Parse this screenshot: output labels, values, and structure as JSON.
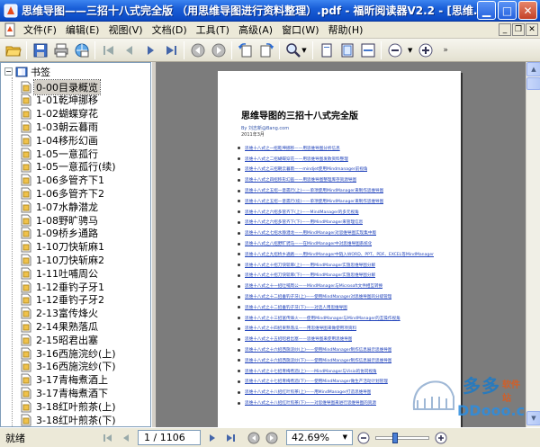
{
  "window": {
    "title": "思维导图——三招十八式完全版 （用思维导图进行资料整理）.pdf - 福昕阅读器V2.2 - [思维..."
  },
  "menu": [
    "文件(F)",
    "编辑(E)",
    "视图(V)",
    "文档(D)",
    "工具(T)",
    "高级(A)",
    "窗口(W)",
    "帮助(H)"
  ],
  "tree": {
    "root_label": "书签",
    "items": [
      "0-00目录概览",
      "1-01乾坤挪移",
      "1-02蝴蝶穿花",
      "1-03朝云暮雨",
      "1-04移形幻画",
      "1-05一意孤行",
      "1-05一意孤行(续)",
      "1-06多管齐下1",
      "1-06多管齐下2",
      "1-07水静潜龙",
      "1-08野旷骋马",
      "1-09桥乡通路",
      "1-10刀快斩麻1",
      "1-10刀快斩麻2",
      "1-11吐哺周公",
      "1-12垂钓子牙1",
      "1-12垂钓子牙2",
      "2-13富传烽火",
      "2-14果熟落瓜",
      "2-15昭君出塞",
      "3-16西施浣纱(上)",
      "3-16西施浣纱(下)",
      "3-17青梅煮酒上",
      "3-17青梅煮酒下",
      "3-18红叶煎茶(上)",
      "3-18红叶煎茶(下)"
    ]
  },
  "document": {
    "title": "思维导图的三招十八式完全版",
    "meta_line1": "By 刘志新@Bang.com",
    "meta_line2": "2011年3月",
    "toc": [
      "思维十八式之一招乾坤挪移——用思维导图分析信息",
      "思维十八式之二招蝴蝶穿花——用思维导图发散资料整理",
      "思维十八式之三招朝云暮雨——mindjet使用Mindmanager前视角",
      "思维十八式之四招移形幻画——用思维导图整理库存资源导图",
      "思维十八式之五招一意孤行(上)——单项使用MindManager来制作思维导图",
      "思维十八式之五招一意孤行(续)——单项使用MindManager来制作思维导图",
      "思维十八式之六招多管齐下(上)——MindManager的多元视角",
      "思维十八式之六招多管齐下(下)——用MindManager来管理信息",
      "思维十八式之七招水静潜龙——用MindManager对思维导图实现集中版",
      "思维十八式之八招野旷骋马——在MindManager中对思维导图系统化",
      "思维十八式之九招桥乡通路——用MindManager中链入WORD、PPT、PDF、EXCEL等MindManager",
      "思维十八式之十招刀快斩麻(上)——用MindManager实施思维导图分解",
      "思维十八式之十招刀快斩麻(下)——用MindManager实施思维导图分解",
      "思维十八式之十一招吐哺周公——MindManager与Microsoft文件相互转换",
      "思维十八式之十二招垂钓子牙(上)——使用MindManager对思维导图的分级管理",
      "思维十八式之十二招垂钓子牙(下)——对话人用思维导图",
      "思维十八式之十三招富传烽火——使用MindManager与MindManager的互操作视角",
      "思维十八式之十四招果熟落瓜——用思维导图来做使用项资料",
      "思维十八式之十五招昭君出塞——思维导图来使用思维导图",
      "思维十八式之十六招西施浣纱(上)——使用MindManager制作信息展示思维导图",
      "思维十八式之十六招西施浣纱(下)——使用MindManager制作信息展示思维导图",
      "思维十八式之十七招青梅煮酒(上)——MindManager与Visio的协同视角",
      "思维十八式之十七招青梅煮酒(下)——使用MindManager做生产活动计划管理",
      "思维十八式之十八招红叶煎茶(上)——用MindManager打造思维导图",
      "思维十八式之十八招红叶煎茶(下)——对思维导图来进行思维导图的资源"
    ]
  },
  "watermark": {
    "text1": "多多",
    "text2": "软件站",
    "text3": "DDooo.com"
  },
  "status": {
    "text": "就绪",
    "page_indicator": "1 / 1106",
    "zoom": "42.69%"
  }
}
